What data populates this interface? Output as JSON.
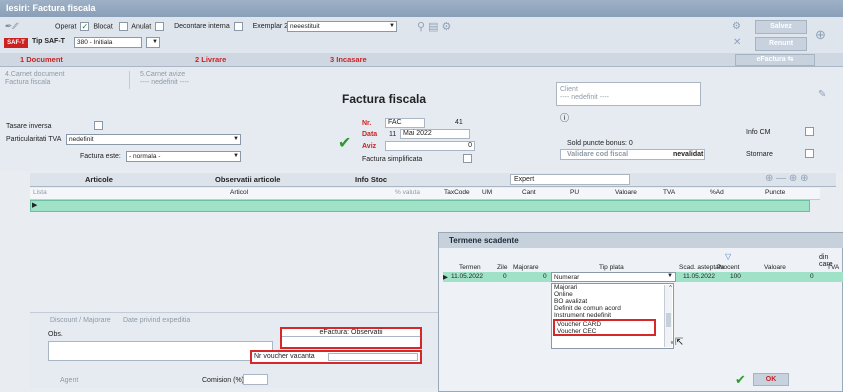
{
  "window": {
    "title": "Iesiri: Factura fiscala"
  },
  "toolbar": {
    "operat": "Operat",
    "blocat": "Blocat",
    "anulat": "Anulat",
    "decontare": "Decontare interna",
    "exemplar_label": "Exemplar 2:",
    "exemplar_value": "neeestituit",
    "doc_badge": "SAF-T",
    "tip_saft_label": "Tip SAF-T",
    "tip_saft_value": "380 - Initiala",
    "salvez": "Salvez",
    "renunt": "Renunt"
  },
  "tabs": {
    "t1": "1 Document",
    "t2": "2 Livrare",
    "t3": "3 Incasare",
    "efactura": "eFactura"
  },
  "document": {
    "carnet": "4.Carnet document",
    "carnet_val": "Factura fiscala",
    "carnet_avize": "5.Carnet avize",
    "carnet_avize_val": "---- nedefinit ----",
    "heading": "Factura fiscala",
    "nr_label": "Nr.",
    "nr_series": "FAC",
    "nr_value": "41",
    "data_label": "Data",
    "data_day": "11",
    "data_month": "Mai 2022",
    "aviz_label": "Aviz",
    "aviz_value": "0",
    "simplificata": "Factura simplificata",
    "tasare": "Tasare inversa",
    "particularitati": "Particularitati TVA",
    "particularitati_val": "nedefinit",
    "factura_este": "Factura este:",
    "factura_este_val": "- normala -",
    "client": "Client",
    "client_val": "---- nedefinit ----",
    "sold_puncte": "Sold puncte bonus: 0",
    "validare": "Validare cod fiscal",
    "nevalidat": "nevalidat",
    "info_cm": "Info CM",
    "stornare": "Stornare"
  },
  "subtabs": {
    "articole": "Articole",
    "observatii": "Observatii articole",
    "info_stoc": "Info Stoc",
    "expert": "Expert"
  },
  "grid": {
    "cols": [
      "Lista",
      "Articol",
      "% valuta",
      "TaxCode",
      "UM",
      "Cant",
      "PU",
      "Valoare",
      "TVA",
      "%Ad",
      "Puncte"
    ]
  },
  "bottom": {
    "tab1": "Discount / Majorare",
    "tab2": "Date privind expeditia",
    "obs": "Obs.",
    "efactura_obs": "eFactura: Observatii",
    "voucher": "Nr voucher vacanta",
    "agent": "Agent",
    "comision": "Comision (%)"
  },
  "dialog": {
    "title": "Termene scadente",
    "din_care": "din care",
    "cols": [
      "Termen",
      "Zile",
      "Majorare",
      "Tip plata",
      "Scad. asteptata",
      "Procent",
      "Valoare",
      "TVA"
    ],
    "row": {
      "termen": "11.05.2022",
      "zile": "0",
      "majorare": "0",
      "tip_plata": "Numerar",
      "scad": "11.05.2022",
      "procent": "100",
      "valoare": "0"
    },
    "options": [
      "Majorari",
      "Online",
      "BO avalizat",
      "Definit de comun acord",
      "Instrument nedefinit",
      "Voucher CARD",
      "Voucher CEC"
    ],
    "ok": "OK"
  },
  "colors": {
    "accent_red": "#d62828",
    "row_green": "#9fe2c8",
    "ok_green": "#2e9a2e"
  }
}
